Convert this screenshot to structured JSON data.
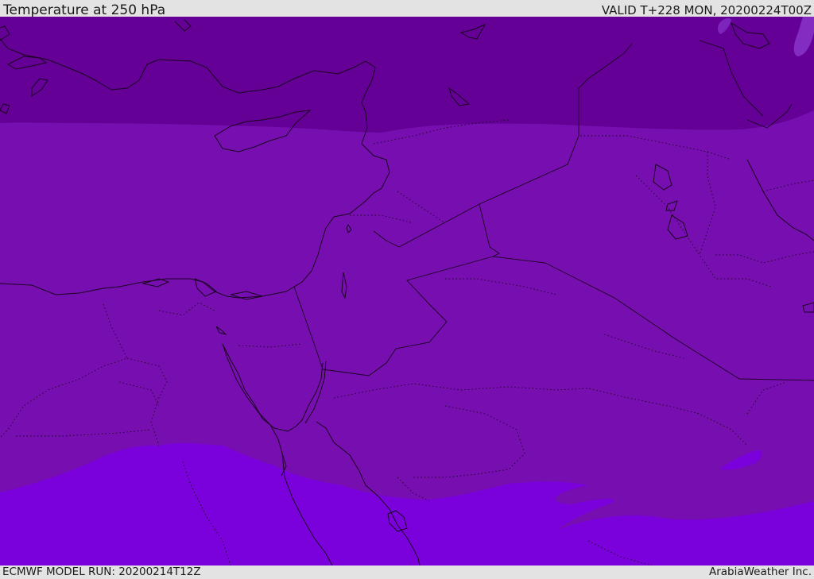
{
  "header": {
    "title": "Temperature at 250 hPa",
    "valid": "VALID T+228 MON, 20200224T00Z"
  },
  "footer": {
    "model_run": "ECMWF MODEL RUN: 20200214T12Z",
    "credit": "ArabiaWeather Inc."
  },
  "map": {
    "region": "Eastern Mediterranean / Middle East",
    "colors": {
      "band_cold": "#640096",
      "band_mid": "#770fb0",
      "band_warm": "#7a00dc",
      "highlight": "#9a50e8",
      "coastline": "#1a001f"
    }
  }
}
